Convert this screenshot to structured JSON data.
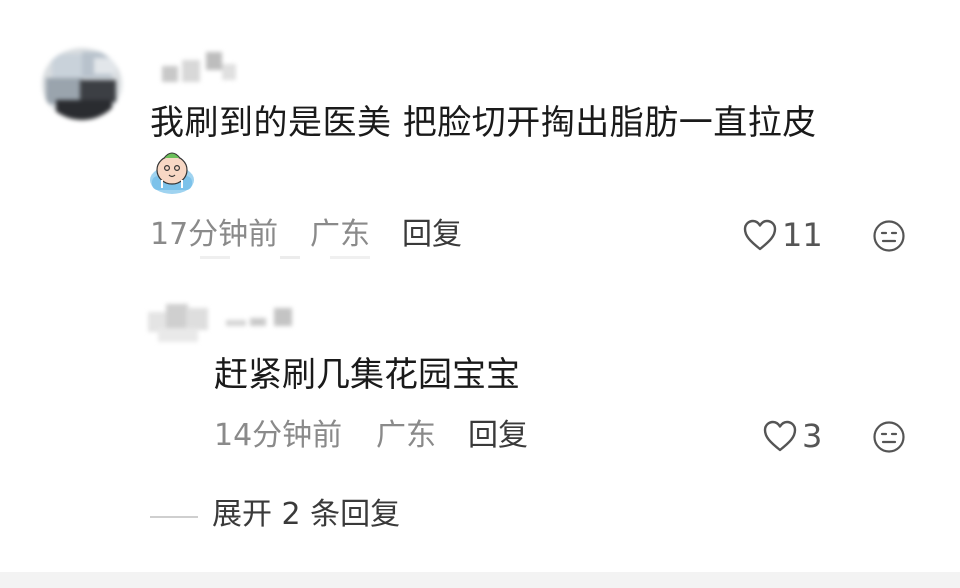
{
  "comment": {
    "text": "我刷到的是医美 把脸切开掏出脂肪一直拉皮",
    "emoji": "crying-emoji",
    "time": "17分钟前",
    "location": "广东",
    "reply_label": "回复",
    "likes": "11"
  },
  "reply": {
    "text": "赶紧刷几集花园宝宝",
    "time": "14分钟前",
    "location": "广东",
    "reply_label": "回复",
    "likes": "3"
  },
  "expand": {
    "label": "展开 2 条回复"
  },
  "colors": {
    "text_primary": "#1a1a1a",
    "text_meta": "#8a8a8a",
    "text_action": "#3a3a3a",
    "icon": "#555555"
  }
}
